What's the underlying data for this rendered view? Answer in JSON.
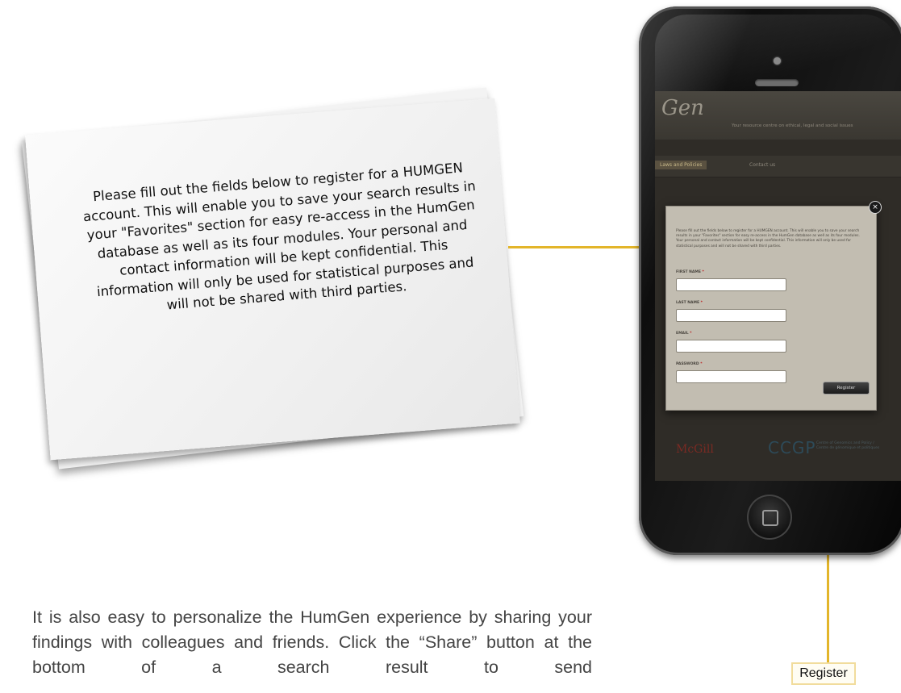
{
  "note": {
    "text": "Please fill out the fields below to register for a HUMGEN account. This will enable you to save your search results in your \"Favorites\" section for easy re-access in the HumGen database as well as its four modules. Your personal and contact information will be kept confidential. This information will only be used for statistical purposes and will not be shared with third parties."
  },
  "phone_screen": {
    "logo": "Gen",
    "tagline": "Your resource centre on ethical, legal and social issues",
    "nav": {
      "active_item": "Laws and Policies",
      "item": "Contact us"
    },
    "modal": {
      "close_label": "×",
      "intro": "Please fill out the fields below to register for a HUMGEN account. This will enable you to save your search results in your \"Favorites\" section for easy re-access in the HumGen database as well as its four modules. Your personal and contact information will be kept confidential. This information will only be used for statistical purposes and will not be shared with third parties.",
      "fields": [
        {
          "label": "FIRST NAME",
          "required_mark": "*",
          "value": ""
        },
        {
          "label": "LAST NAME",
          "required_mark": "*",
          "value": ""
        },
        {
          "label": "EMAIL",
          "required_mark": "*",
          "value": ""
        },
        {
          "label": "PASSWORD",
          "required_mark": "*",
          "value": ""
        }
      ],
      "register_button": "Register"
    },
    "footer": {
      "mcgill": "McGill",
      "ccgp": "CCGP",
      "ccgp_sub": "Centre of Genomics and Policy / Centre de génomique et politiques"
    }
  },
  "callout": {
    "register_label": "Register",
    "line_color": "#e3b52a"
  },
  "body": {
    "paragraph": "It is also easy to personalize the HumGen experience by sharing your findings with colleagues and friends. Click the “Share” button at the bottom of a search result to send"
  }
}
